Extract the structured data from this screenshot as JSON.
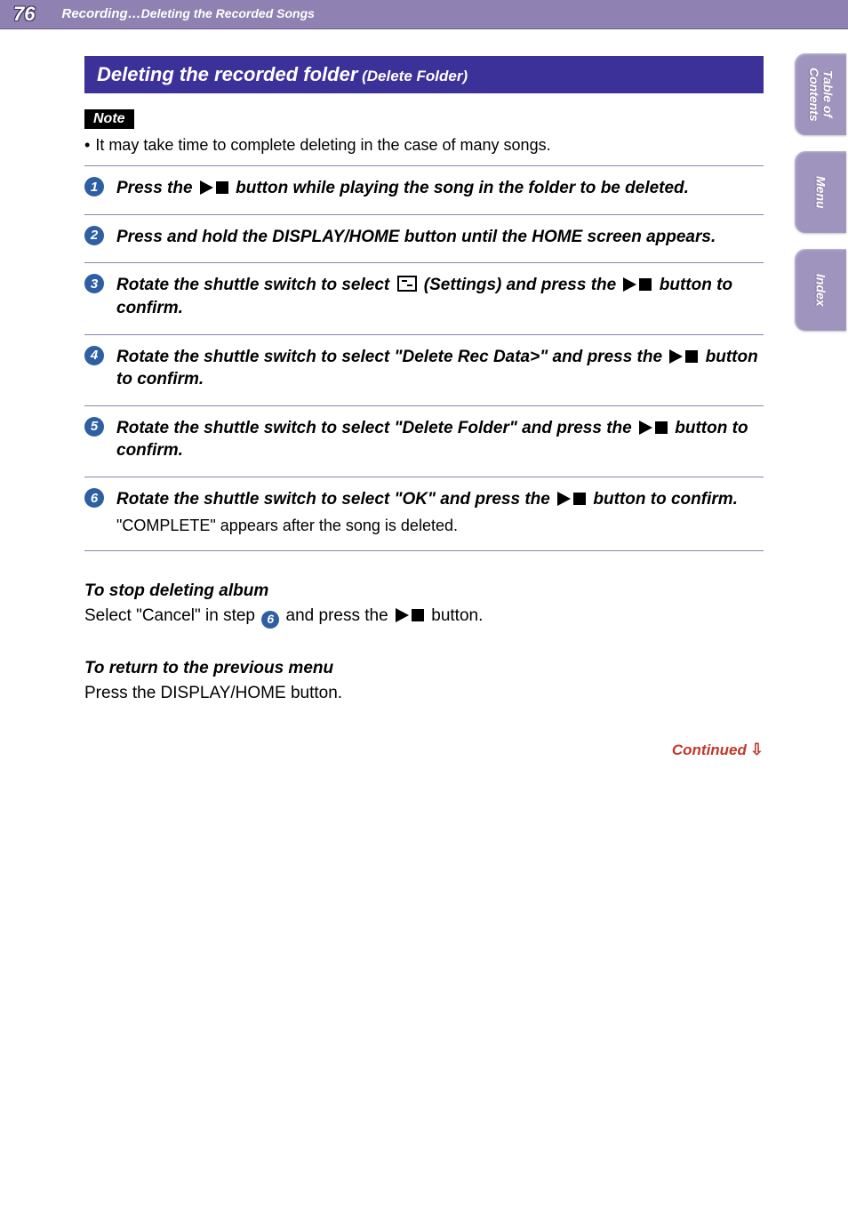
{
  "header": {
    "page_number": "76",
    "breadcrumb_main": "Recording…",
    "breadcrumb_sub": "Deleting the Recorded Songs"
  },
  "section": {
    "title_main": "Deleting the recorded folder",
    "title_sub": " (Delete Folder)"
  },
  "note": {
    "label": "Note",
    "items": [
      "It may take time to complete deleting in the case of many songs."
    ]
  },
  "steps": [
    {
      "num": "1",
      "parts": [
        {
          "t": "text",
          "v": "Press the "
        },
        {
          "t": "playstop"
        },
        {
          "t": "text",
          "v": " button while playing the song in the folder to be deleted."
        }
      ]
    },
    {
      "num": "2",
      "parts": [
        {
          "t": "text",
          "v": "Press and hold the DISPLAY/HOME button until the HOME screen appears."
        }
      ]
    },
    {
      "num": "3",
      "parts": [
        {
          "t": "text",
          "v": "Rotate the shuttle switch to select "
        },
        {
          "t": "settings"
        },
        {
          "t": "text",
          "v": " (Settings) and press the "
        },
        {
          "t": "playstop"
        },
        {
          "t": "text",
          "v": " button to confirm."
        }
      ]
    },
    {
      "num": "4",
      "parts": [
        {
          "t": "text",
          "v": "Rotate the shuttle switch to select \"Delete Rec Data>\" and press the "
        },
        {
          "t": "playstop"
        },
        {
          "t": "text",
          "v": " button to confirm."
        }
      ]
    },
    {
      "num": "5",
      "parts": [
        {
          "t": "text",
          "v": "Rotate the shuttle switch to select \"Delete Folder\" and press the "
        },
        {
          "t": "playstop"
        },
        {
          "t": "text",
          "v": " button to confirm."
        }
      ]
    },
    {
      "num": "6",
      "parts": [
        {
          "t": "text",
          "v": "Rotate the shuttle switch to select \"OK\" and press the "
        },
        {
          "t": "playstop"
        },
        {
          "t": "text",
          "v": " button to confirm."
        }
      ],
      "result": "\"COMPLETE\" appears after the song is deleted."
    }
  ],
  "stop_deleting": {
    "heading": "To stop deleting album",
    "pre": "Select \"Cancel\" in step ",
    "step_ref": "6",
    "mid": " and press the ",
    "post": " button."
  },
  "return_menu": {
    "heading": "To return to the previous menu",
    "body": "Press the DISPLAY/HOME button."
  },
  "continued": "Continued",
  "tabs": [
    "Table of Contents",
    "Menu",
    "Index"
  ]
}
